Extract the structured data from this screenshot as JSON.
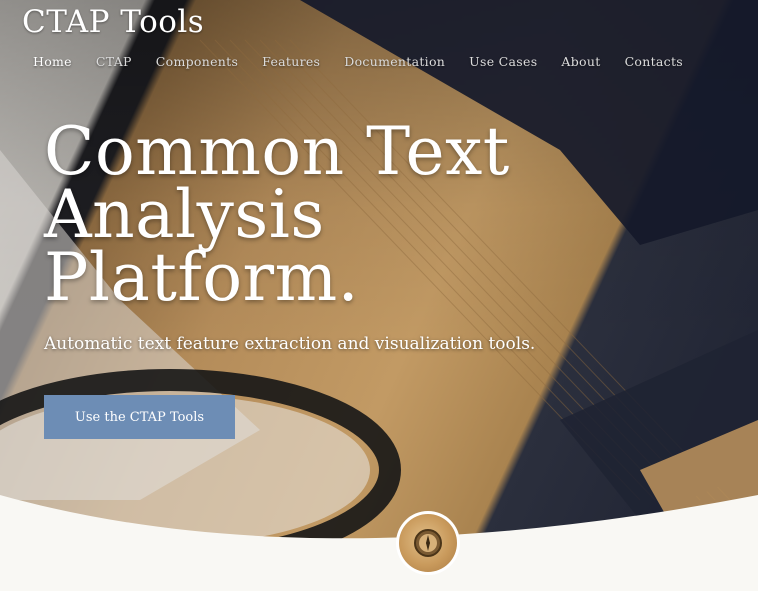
{
  "site": {
    "title": "CTAP Tools"
  },
  "nav": {
    "items": [
      {
        "label": "Home",
        "active": true
      },
      {
        "label": "CTAP"
      },
      {
        "label": "Components"
      },
      {
        "label": "Features"
      },
      {
        "label": "Documentation"
      },
      {
        "label": "Use Cases"
      },
      {
        "label": "About"
      },
      {
        "label": "Contacts"
      }
    ]
  },
  "hero": {
    "headline_line1": "Common Text",
    "headline_line2": "Analysis",
    "headline_line3": "Platform.",
    "subtitle": "Automatic text feature extraction and visualization tools.",
    "cta_label": "Use the CTAP Tools"
  },
  "colors": {
    "cta_background": "#6d8db5",
    "page_background": "#f9f8f4"
  },
  "icons": {
    "badge": "compass-icon"
  }
}
